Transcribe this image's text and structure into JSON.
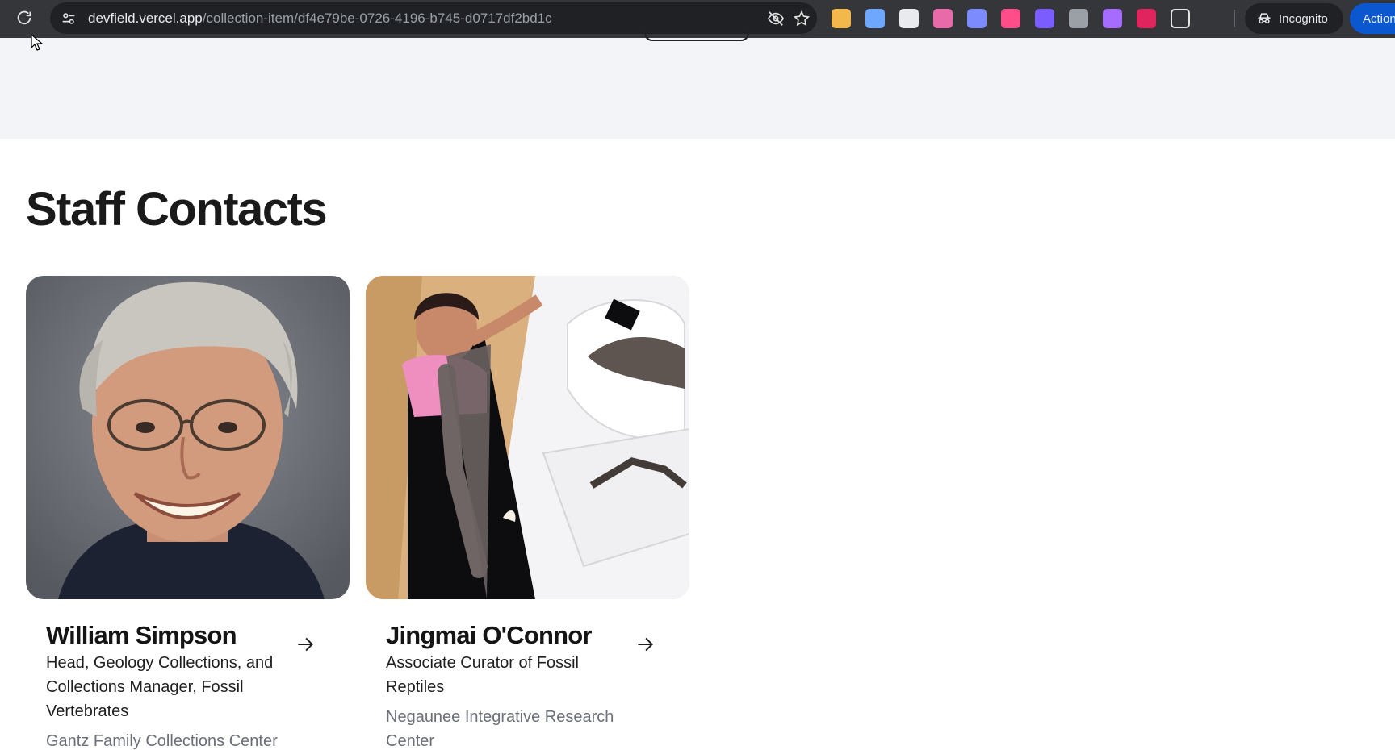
{
  "browser": {
    "url_host": "devfield.vercel.app",
    "url_path": "/collection-item/df4e79be-0726-4196-b745-d0717df2bd1c",
    "incognito_label": "Incognito",
    "actions_label": "Action",
    "extensions": [
      {
        "icon": "notes-extension-icon",
        "color": "#f2b84b"
      },
      {
        "icon": "docs-extension-icon",
        "color": "#6ea8fe"
      },
      {
        "icon": "record-extension-icon",
        "color": "#e8eaed"
      },
      {
        "icon": "gradient-extension-icon",
        "color": "#e86aa8"
      },
      {
        "icon": "eyedropper-extension-icon",
        "color": "#7c8cff"
      },
      {
        "icon": "video-extension-icon",
        "color": "#ff4d8a"
      },
      {
        "icon": "color-extension-icon",
        "color": "#7b5cff"
      },
      {
        "icon": "compass-extension-icon",
        "color": "#9aa0a6"
      },
      {
        "icon": "lens-extension-icon",
        "color": "#a66bff"
      },
      {
        "icon": "shield-extension-icon",
        "color": "#e0245e"
      },
      {
        "icon": "puzzle-extensions-icon",
        "color": "#e3e3e3"
      }
    ]
  },
  "section": {
    "heading": "Staff Contacts"
  },
  "staff": [
    {
      "name": "William Simpson",
      "title": "Head, Geology Collections, and Collections Manager, Fossil Vertebrates",
      "department": "Gantz Family Collections Center"
    },
    {
      "name": "Jingmai O'Connor",
      "title": "Associate Curator of Fossil Reptiles",
      "department": "Negaunee Integrative Research Center"
    }
  ],
  "colors": {
    "toolbar": "#35363a",
    "omnibox": "#202124",
    "band": "#f3f4f8",
    "accent": "#0b57d0"
  }
}
